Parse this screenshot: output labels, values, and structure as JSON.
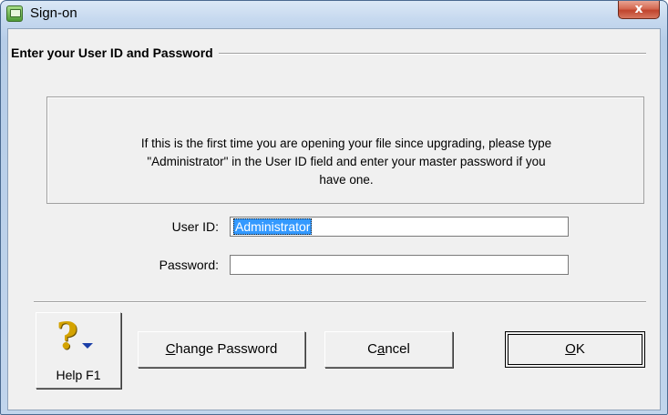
{
  "window": {
    "title": "Sign-on",
    "close_glyph": "x",
    "icon": "app-icon"
  },
  "group": {
    "title": "Enter your User ID and Password"
  },
  "info": {
    "line1": "If this is the first time you are opening your file since upgrading, please type",
    "line2": "\"Administrator\" in the User ID field and enter your master password if you",
    "line3": "have one."
  },
  "form": {
    "user_id_label": "User ID:",
    "user_id_value": "Administrator",
    "password_label": "Password:",
    "password_value": ""
  },
  "buttons": {
    "help_label": "Help F1",
    "help_icon": "help-question-icon",
    "change_password": {
      "mnemonic": "C",
      "rest": "hange Password"
    },
    "cancel": {
      "pre": "C",
      "mnemonic": "a",
      "rest": "ncel"
    },
    "ok": {
      "mnemonic": "O",
      "rest": "K"
    }
  },
  "colors": {
    "selection": "#3399ff",
    "close_button": "#c0442d",
    "help_icon": "#d4a300"
  }
}
